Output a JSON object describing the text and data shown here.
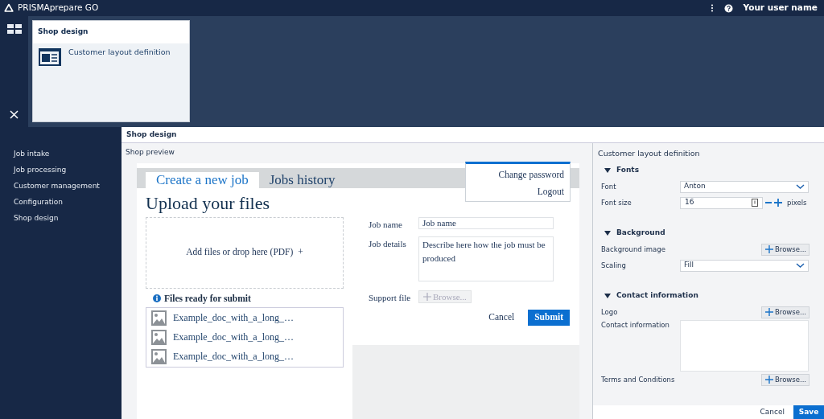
{
  "app": {
    "title": "PRISMAprepare GO",
    "user": "Your user name"
  },
  "menu_popup": {
    "title": "Shop design",
    "items": [
      {
        "label": "Customer layout definition"
      }
    ]
  },
  "sidebar": {
    "items": [
      {
        "label": "Job intake"
      },
      {
        "label": "Job processing"
      },
      {
        "label": "Customer management"
      },
      {
        "label": "Configuration"
      },
      {
        "label": "Shop design"
      }
    ]
  },
  "page": {
    "title": "Shop design"
  },
  "preview": {
    "title": "Shop preview",
    "tabs": [
      {
        "label": "Create a new job",
        "selected": true
      },
      {
        "label": "Jobs history",
        "selected": false
      }
    ],
    "user_menu": [
      "Change password",
      "Logout"
    ],
    "heading": "Upload your files",
    "dropzone": {
      "text": "Add files or drop here (PDF)",
      "icon": "+"
    },
    "files_title": "Files ready for submit",
    "files": [
      "Example_doc_with_a_long_…",
      "Example_doc_with_a_long_…",
      "Example_doc_with_a_long_…"
    ],
    "form": {
      "fields": [
        {
          "label": "Job name",
          "kind": "input",
          "placeholder": "Job name"
        },
        {
          "label": "Job details",
          "kind": "textarea",
          "placeholder": "Describe here how the job must be produced"
        },
        {
          "label": "Support file",
          "kind": "browse",
          "button": "Browse...",
          "disabled": true
        }
      ],
      "buttons": [
        {
          "label": "Cancel",
          "kind": "secondary"
        },
        {
          "label": "Submit",
          "kind": "primary"
        }
      ]
    }
  },
  "settings": {
    "title": "Customer layout definition",
    "sections": [
      {
        "title": "Fonts",
        "expanded": true,
        "rows": [
          {
            "label": "Font",
            "kind": "select",
            "value": "Anton"
          },
          {
            "label": "Font size",
            "kind": "number",
            "value": "16",
            "unit": "pixels"
          }
        ]
      },
      {
        "title": "Background",
        "expanded": true,
        "rows": [
          {
            "label": "Background image",
            "kind": "browse",
            "button": "Browse..."
          },
          {
            "label": "Scaling",
            "kind": "select",
            "value": "Fill"
          }
        ]
      },
      {
        "title": "Contact information",
        "expanded": true,
        "rows": [
          {
            "label": "Logo",
            "kind": "browse",
            "button": "Browse..."
          },
          {
            "label": "Contact information",
            "kind": "textarea"
          },
          {
            "label": "Terms and Conditions",
            "kind": "browse",
            "button": "Browse..."
          }
        ]
      }
    ],
    "buttons": [
      {
        "label": "Cancel",
        "kind": "secondary"
      },
      {
        "label": "Save",
        "kind": "primary"
      }
    ]
  }
}
